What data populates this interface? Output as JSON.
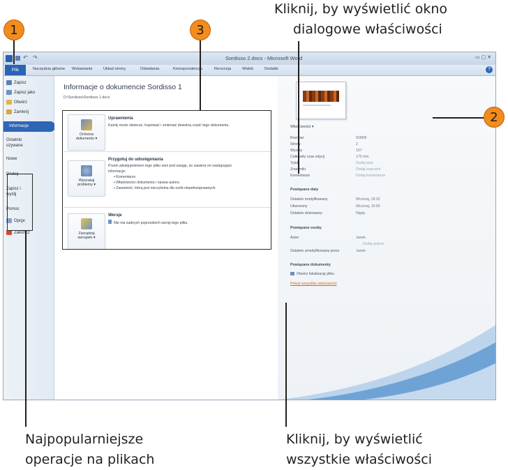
{
  "callouts": {
    "top_right_line1": "Kliknij, by wyświetlić okno",
    "top_right_line2": "dialogowe właściwości",
    "bottom_left_line1": "Najpopularniejsze",
    "bottom_left_line2": "operacje na plikach",
    "bottom_right_line1": "Kliknij, by wyświetlić",
    "bottom_right_line2": "wszystkie właściwości",
    "badge1": "1",
    "badge2": "2",
    "badge3": "3"
  },
  "window": {
    "title": "Sordisso 2.docx - Microsoft Word",
    "controls": "▭ ▢ ✕"
  },
  "ribbon_tabs": [
    "Plik",
    "Narzędzia główne",
    "Wstawianie",
    "Układ strony",
    "Odwołania",
    "Korespondencja",
    "Recenzja",
    "Widok",
    "Dodatki"
  ],
  "nav": {
    "save": "Zapisz",
    "save_as": "Zapisz jako",
    "open": "Otwórz",
    "close": "Zamknij",
    "info": "Informacje",
    "recent_line1": "Ostatnio",
    "recent_line2": "używane",
    "new": "Nowe",
    "print": "Drukuj",
    "save_send_line1": "Zapisz i",
    "save_send_line2": "wyślij",
    "help": "Pomoc",
    "options": "Opcje",
    "exit": "Zakończ"
  },
  "info": {
    "heading": "Informacje o dokumencie Sordisso 1",
    "path": "D:\\Sordisso\\Sordisso 1.docx",
    "permissions_title": "Uprawnienia",
    "permissions_desc": "Każdy może otwierać, kopiować i zmieniać dowolną część tego dokumentu.",
    "protect_button_line1": "Ochrona",
    "protect_button_line2": "dokumentu ▾",
    "prepare_title": "Przygotuj do udostępniania",
    "prepare_desc1": "Przed udostępnieniem tego pliku weź pod uwagę, że zawiera on następujące",
    "prepare_desc2": "informacje:",
    "prepare_bullets": [
      "Komentarze",
      "Właściwości dokumentu i nazwa autora",
      "Zawartość, którą jest nieczytelna dla osób niepełnosprawnych."
    ],
    "check_button_line1": "Wyszukaj",
    "check_button_line2": "problemy ▾",
    "versions_title": "Wersje",
    "versions_desc": "Nie ma żadnych poprzednich wersji tego pliku.",
    "versions_button_line1": "Zarządzaj",
    "versions_button_line2": "wersjami ▾"
  },
  "properties": {
    "header": "Właściwości ▾",
    "rows": [
      {
        "label": "Rozmiar",
        "value": "928KB"
      },
      {
        "label": "Strony",
        "value": "2"
      },
      {
        "label": "Wyrazy",
        "value": "157"
      },
      {
        "label": "Całkowity czas edycji",
        "value": "170 min"
      },
      {
        "label": "Tytuł",
        "value": "Dodaj tytuł"
      },
      {
        "label": "Znaczniki",
        "value": "Dodaj znacznik"
      },
      {
        "label": "Komentarze",
        "value": "Dodaj komentarze"
      }
    ],
    "dates_header": "Powiązane daty",
    "dates": [
      {
        "label": "Ostatnio modyfikowany",
        "value": "Wczoraj, 19:32"
      },
      {
        "label": "Utworzony",
        "value": "Wczoraj, 16:56"
      },
      {
        "label": "Ostatnio drukowany",
        "value": "Nigdy"
      }
    ],
    "people_header": "Powiązane osoby",
    "author_label": "Autor",
    "author_value": "Janek",
    "add_author": "Dodaj autora",
    "last_modified_by_label": "Ostatnio zmodyfikowany przez",
    "last_modified_by_value": "Janek",
    "docs_header": "Powiązane dokumenty",
    "open_location": "Otwórz lokalizację pliku",
    "show_all": "Pokaż wszystkie właściwości"
  }
}
